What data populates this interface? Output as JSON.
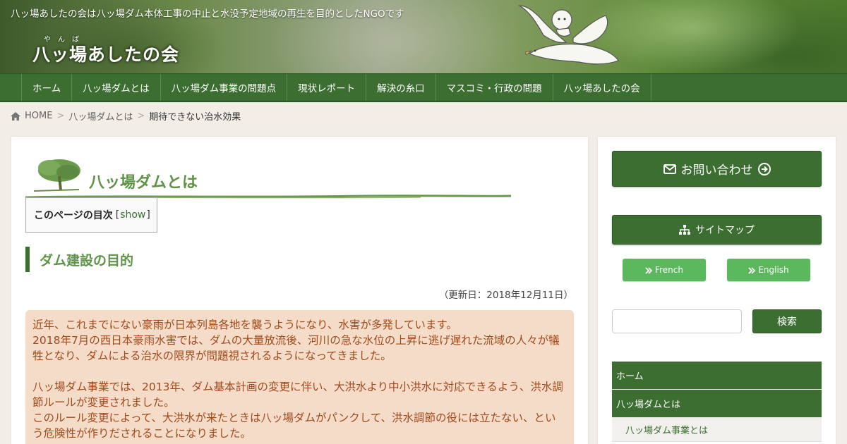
{
  "header": {
    "tagline": "八ッ場あしたの会は八ッ場ダム本体工事の中止と水没予定地域の再生を目的としたNGOです",
    "logo_text": "八ッ場あしたの会",
    "logo_ruby": "やんば"
  },
  "nav": {
    "items": [
      "ホーム",
      "八ッ場ダムとは",
      "八ッ場ダム事業の問題点",
      "現状レポート",
      "解決の糸口",
      "マスコミ・行政の問題",
      "八ッ場あしたの会"
    ]
  },
  "breadcrumb": {
    "home_icon": "home-icon",
    "home": "HOME",
    "parent": "八ッ場ダムとは",
    "current": "期待できない治水効果"
  },
  "main": {
    "heading": "八ッ場ダムとは",
    "toc": {
      "label": "このページの目次",
      "bracket_open": "[",
      "toggle": "show",
      "bracket_close": "]"
    },
    "section_title": "ダム建設の目的",
    "updated": "（更新日：2018年12月11日）",
    "notice": {
      "p1": "近年、これまでにない豪雨が日本列島各地を襲うようになり、水害が多発しています。",
      "p2": "2018年7月の西日本豪雨水害では、ダムの大量放流後、河川の急な水位の上昇に逃げ遅れた流域の人々が犠牲となり、ダムによる治水の限界が問題視されるようになってきました。",
      "p3": "八ッ場ダム事業では、2013年、ダム基本計画の変更に伴い、大洪水より中小洪水に対応できるよう、洪水調節ルールが変更されました。",
      "p4": "このルール変更によって、大洪水が来たときは八ッ場ダムがパンクして、洪水調節の役には立たない、という危険性が作りだされることになりました。"
    }
  },
  "sidebar": {
    "contact_label": "お問い合わせ",
    "contact_icons": [
      "envelope-icon",
      "arrow-circle-right-icon"
    ],
    "sitemap_label": "サイトマップ",
    "sitemap_icon": "sitemap-icon",
    "lang_french": "French",
    "lang_english": "English",
    "lang_icon": "double-chevron-right-icon",
    "search_value": "",
    "search_button": "検索",
    "menu": {
      "items": [
        "ホーム",
        "八ッ場ダムとは"
      ],
      "sub_items": [
        "八ッ場ダム事業とは"
      ]
    }
  },
  "colors": {
    "brand_green": "#3c6e32",
    "heading_green": "#5f9448",
    "notice_bg": "#f5dcc8",
    "notice_text": "#a04a1c",
    "lang_button": "#5cb85c",
    "page_bg": "#f2eee7"
  }
}
